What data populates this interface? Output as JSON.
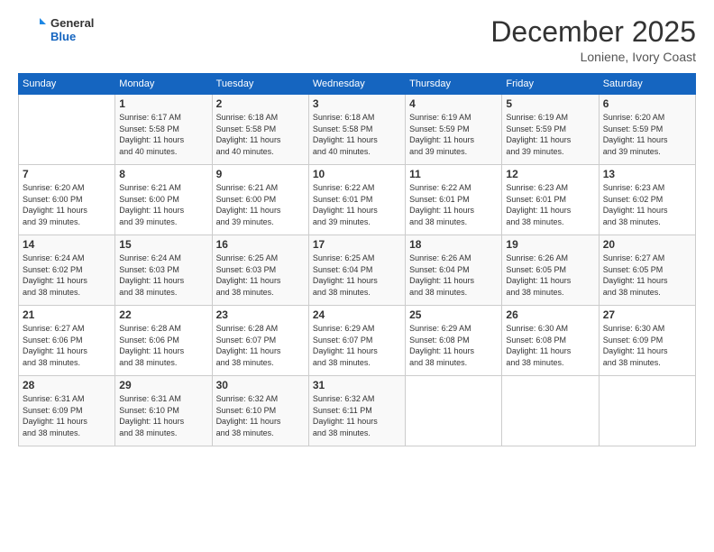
{
  "logo": {
    "line1": "General",
    "line2": "Blue"
  },
  "header": {
    "title": "December 2025",
    "subtitle": "Loniene, Ivory Coast"
  },
  "days_of_week": [
    "Sunday",
    "Monday",
    "Tuesday",
    "Wednesday",
    "Thursday",
    "Friday",
    "Saturday"
  ],
  "weeks": [
    [
      {
        "day": "",
        "info": ""
      },
      {
        "day": "1",
        "info": "Sunrise: 6:17 AM\nSunset: 5:58 PM\nDaylight: 11 hours\nand 40 minutes."
      },
      {
        "day": "2",
        "info": "Sunrise: 6:18 AM\nSunset: 5:58 PM\nDaylight: 11 hours\nand 40 minutes."
      },
      {
        "day": "3",
        "info": "Sunrise: 6:18 AM\nSunset: 5:58 PM\nDaylight: 11 hours\nand 40 minutes."
      },
      {
        "day": "4",
        "info": "Sunrise: 6:19 AM\nSunset: 5:59 PM\nDaylight: 11 hours\nand 39 minutes."
      },
      {
        "day": "5",
        "info": "Sunrise: 6:19 AM\nSunset: 5:59 PM\nDaylight: 11 hours\nand 39 minutes."
      },
      {
        "day": "6",
        "info": "Sunrise: 6:20 AM\nSunset: 5:59 PM\nDaylight: 11 hours\nand 39 minutes."
      }
    ],
    [
      {
        "day": "7",
        "info": "Sunrise: 6:20 AM\nSunset: 6:00 PM\nDaylight: 11 hours\nand 39 minutes."
      },
      {
        "day": "8",
        "info": "Sunrise: 6:21 AM\nSunset: 6:00 PM\nDaylight: 11 hours\nand 39 minutes."
      },
      {
        "day": "9",
        "info": "Sunrise: 6:21 AM\nSunset: 6:00 PM\nDaylight: 11 hours\nand 39 minutes."
      },
      {
        "day": "10",
        "info": "Sunrise: 6:22 AM\nSunset: 6:01 PM\nDaylight: 11 hours\nand 39 minutes."
      },
      {
        "day": "11",
        "info": "Sunrise: 6:22 AM\nSunset: 6:01 PM\nDaylight: 11 hours\nand 38 minutes."
      },
      {
        "day": "12",
        "info": "Sunrise: 6:23 AM\nSunset: 6:01 PM\nDaylight: 11 hours\nand 38 minutes."
      },
      {
        "day": "13",
        "info": "Sunrise: 6:23 AM\nSunset: 6:02 PM\nDaylight: 11 hours\nand 38 minutes."
      }
    ],
    [
      {
        "day": "14",
        "info": "Sunrise: 6:24 AM\nSunset: 6:02 PM\nDaylight: 11 hours\nand 38 minutes."
      },
      {
        "day": "15",
        "info": "Sunrise: 6:24 AM\nSunset: 6:03 PM\nDaylight: 11 hours\nand 38 minutes."
      },
      {
        "day": "16",
        "info": "Sunrise: 6:25 AM\nSunset: 6:03 PM\nDaylight: 11 hours\nand 38 minutes."
      },
      {
        "day": "17",
        "info": "Sunrise: 6:25 AM\nSunset: 6:04 PM\nDaylight: 11 hours\nand 38 minutes."
      },
      {
        "day": "18",
        "info": "Sunrise: 6:26 AM\nSunset: 6:04 PM\nDaylight: 11 hours\nand 38 minutes."
      },
      {
        "day": "19",
        "info": "Sunrise: 6:26 AM\nSunset: 6:05 PM\nDaylight: 11 hours\nand 38 minutes."
      },
      {
        "day": "20",
        "info": "Sunrise: 6:27 AM\nSunset: 6:05 PM\nDaylight: 11 hours\nand 38 minutes."
      }
    ],
    [
      {
        "day": "21",
        "info": "Sunrise: 6:27 AM\nSunset: 6:06 PM\nDaylight: 11 hours\nand 38 minutes."
      },
      {
        "day": "22",
        "info": "Sunrise: 6:28 AM\nSunset: 6:06 PM\nDaylight: 11 hours\nand 38 minutes."
      },
      {
        "day": "23",
        "info": "Sunrise: 6:28 AM\nSunset: 6:07 PM\nDaylight: 11 hours\nand 38 minutes."
      },
      {
        "day": "24",
        "info": "Sunrise: 6:29 AM\nSunset: 6:07 PM\nDaylight: 11 hours\nand 38 minutes."
      },
      {
        "day": "25",
        "info": "Sunrise: 6:29 AM\nSunset: 6:08 PM\nDaylight: 11 hours\nand 38 minutes."
      },
      {
        "day": "26",
        "info": "Sunrise: 6:30 AM\nSunset: 6:08 PM\nDaylight: 11 hours\nand 38 minutes."
      },
      {
        "day": "27",
        "info": "Sunrise: 6:30 AM\nSunset: 6:09 PM\nDaylight: 11 hours\nand 38 minutes."
      }
    ],
    [
      {
        "day": "28",
        "info": "Sunrise: 6:31 AM\nSunset: 6:09 PM\nDaylight: 11 hours\nand 38 minutes."
      },
      {
        "day": "29",
        "info": "Sunrise: 6:31 AM\nSunset: 6:10 PM\nDaylight: 11 hours\nand 38 minutes."
      },
      {
        "day": "30",
        "info": "Sunrise: 6:32 AM\nSunset: 6:10 PM\nDaylight: 11 hours\nand 38 minutes."
      },
      {
        "day": "31",
        "info": "Sunrise: 6:32 AM\nSunset: 6:11 PM\nDaylight: 11 hours\nand 38 minutes."
      },
      {
        "day": "",
        "info": ""
      },
      {
        "day": "",
        "info": ""
      },
      {
        "day": "",
        "info": ""
      }
    ]
  ]
}
